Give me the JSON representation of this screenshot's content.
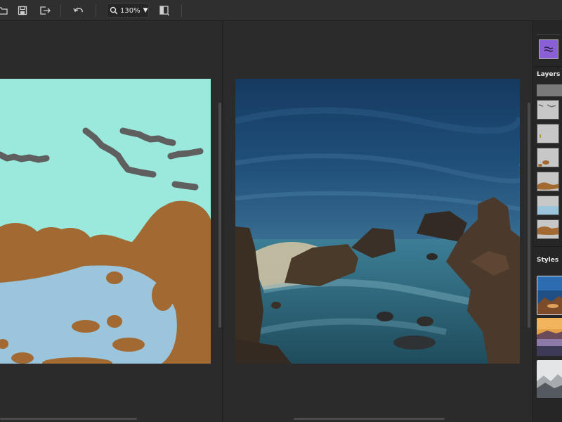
{
  "toolbar": {
    "open_icon": "folder-open-icon",
    "save_icon": "save-icon",
    "export_icon": "export-icon",
    "undo_icon": "undo-icon",
    "zoom": {
      "icon": "magnifier-icon",
      "value": "130%",
      "arrow": "▼"
    },
    "compare_icon": "split-view-icon"
  },
  "panel": {
    "brush_icon": "water-brush-icon",
    "brush_color": "#8b5fd6",
    "layers_title": "Layers",
    "styles_title": "Styles",
    "layers": [
      {
        "name": "sky-layer",
        "color": "#7a7a7a"
      },
      {
        "name": "cloud-layer"
      },
      {
        "name": "tree-layer"
      },
      {
        "name": "rock-layer"
      },
      {
        "name": "ground-layer"
      },
      {
        "name": "water-layer"
      },
      {
        "name": "mountain-layer"
      }
    ]
  },
  "colors": {
    "sky_paint": "#9ae9dc",
    "cloud_paint": "#5f5f5f",
    "rock_paint": "#a26a32",
    "water_paint": "#9ac5dc"
  }
}
